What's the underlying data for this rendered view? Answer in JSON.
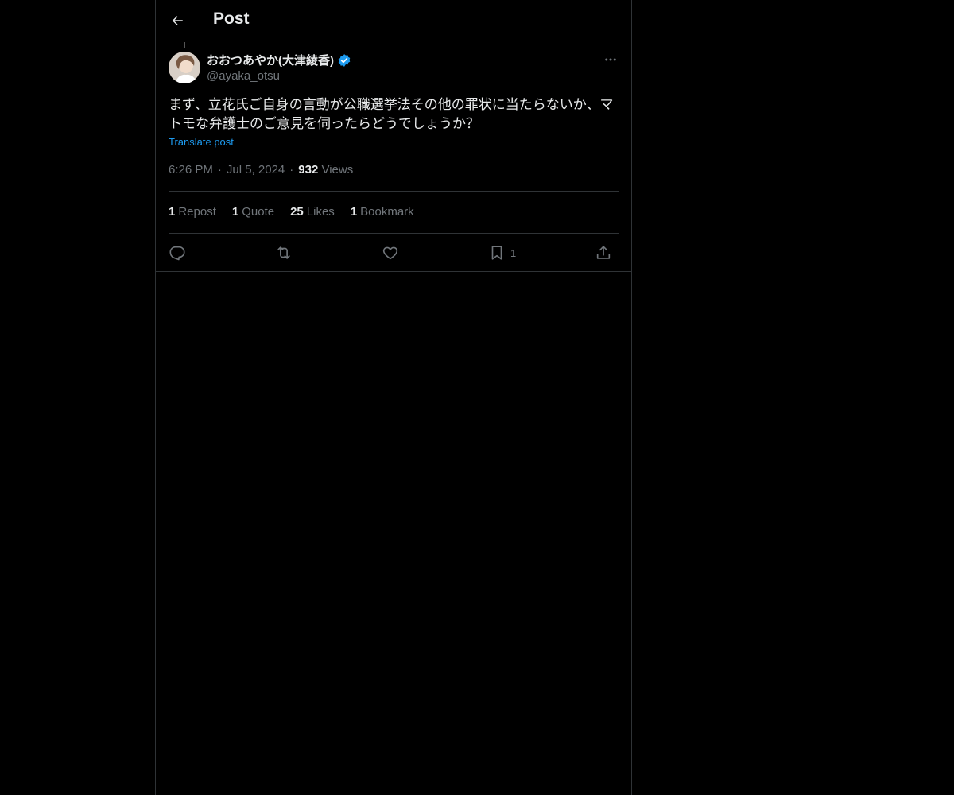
{
  "header": {
    "title": "Post"
  },
  "author": {
    "display_name": "おおつあやか(大津綾香)",
    "handle": "@ayaka_otsu",
    "verified_color": "#1d9bf0"
  },
  "post": {
    "text": "まず、立花氏ご自身の言動が公職選挙法その他の罪状に当たらないか、マトモな弁護士のご意見を伺ったらどうでしょうか？",
    "translate_label": "Translate post",
    "time": "6:26 PM",
    "date": "Jul 5, 2024",
    "views_count": "932",
    "views_label": "Views"
  },
  "stats": [
    {
      "count": "1",
      "label": "Repost"
    },
    {
      "count": "1",
      "label": "Quote"
    },
    {
      "count": "25",
      "label": "Likes"
    },
    {
      "count": "1",
      "label": "Bookmark"
    }
  ],
  "actions": {
    "bookmark_count": "1"
  },
  "colors": {
    "background": "#000000",
    "text": "#e7e9ea",
    "muted": "#71767b",
    "accent": "#1d9bf0",
    "border": "#2f3336"
  }
}
